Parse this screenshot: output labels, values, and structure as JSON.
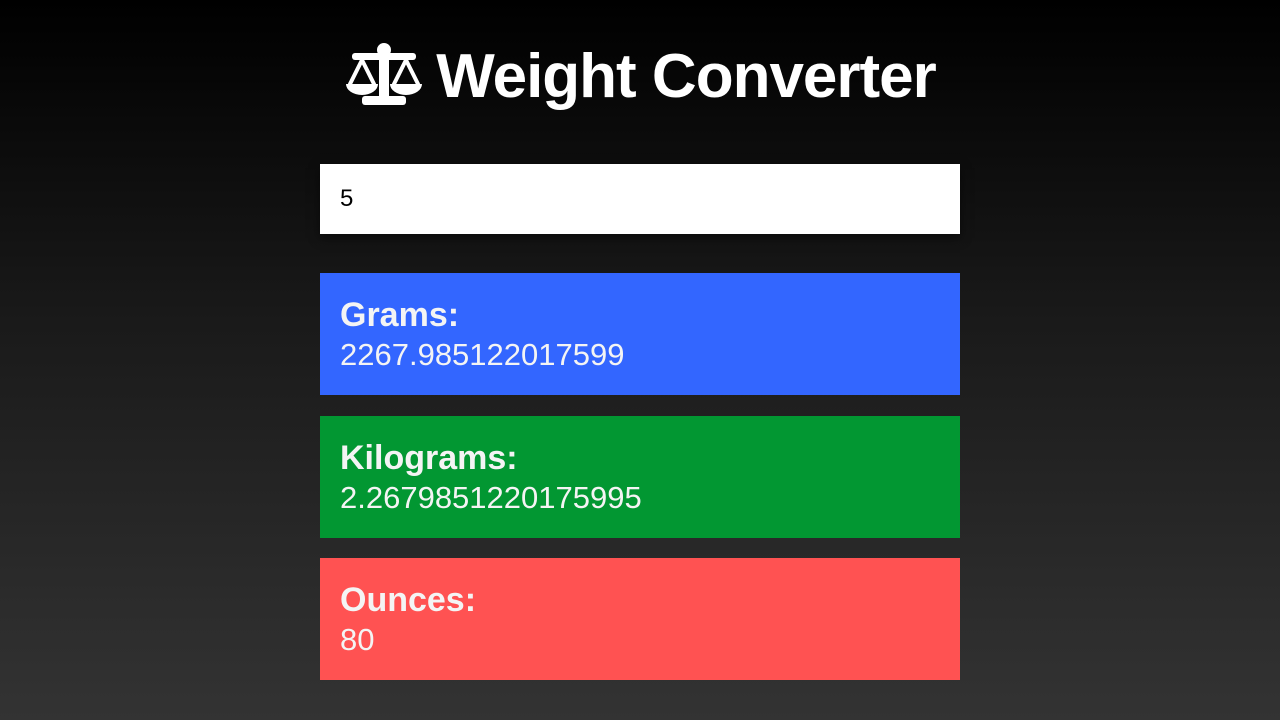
{
  "header": {
    "title": "Weight Converter",
    "icon": "balance-scale-icon"
  },
  "input": {
    "value": "5",
    "placeholder": ""
  },
  "results": [
    {
      "label": "Grams:",
      "value": "2267.985122017599",
      "color": "#3366ff"
    },
    {
      "label": "Kilograms:",
      "value": "2.2679851220175995",
      "color": "#029732"
    },
    {
      "label": "Ounces:",
      "value": "80",
      "color": "#ff5252"
    }
  ]
}
